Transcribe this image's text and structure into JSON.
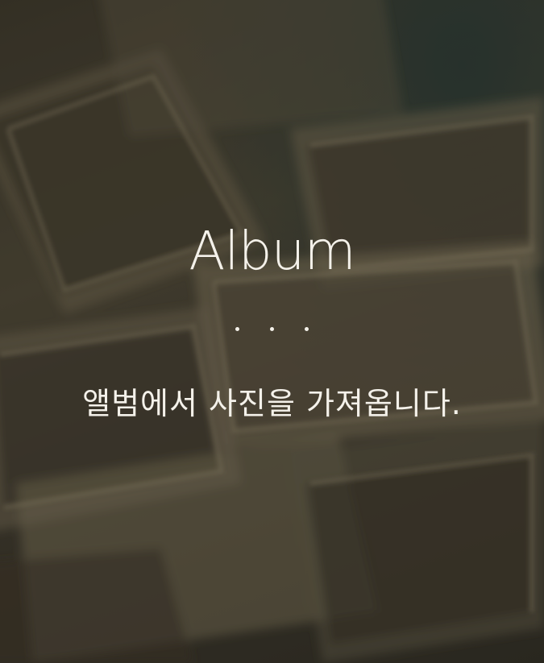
{
  "screen": {
    "title": "Album",
    "subtitle": "앨범에서 사진을 가져옵니다.",
    "page_indicator_dots": 3,
    "background": "blurred-old-photographs-sepia",
    "colors": {
      "text": "#f4f1ea",
      "background_dark": "#2e2b23",
      "background_sepia": "#4a4434"
    }
  }
}
